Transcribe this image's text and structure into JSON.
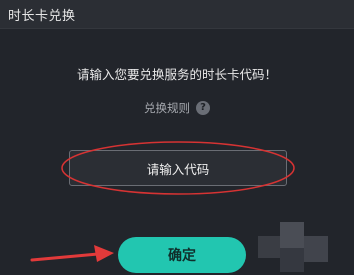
{
  "window": {
    "title": "时长卡兑换"
  },
  "dialog": {
    "prompt": "请输入您要兑换服务的时长卡代码！",
    "rules_label": "兑换规则",
    "help_glyph": "?",
    "code_input": {
      "value": "",
      "placeholder": "请输入代码"
    },
    "confirm_label": "确定"
  },
  "annotation": {
    "ellipse_color": "#d63333",
    "arrow_color": "#e23a3a"
  },
  "icons": {
    "help": "question-circle-icon"
  },
  "colors": {
    "accent": "#22c6b0",
    "background": "#22252b"
  }
}
